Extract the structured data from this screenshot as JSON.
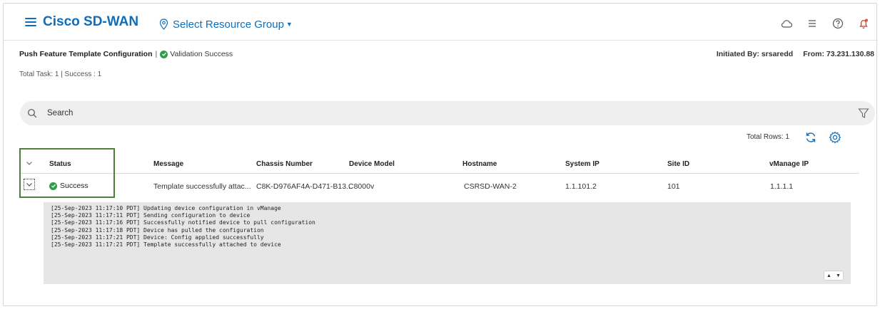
{
  "header": {
    "brand": "Cisco SD-WAN",
    "resource_group": "Select Resource Group",
    "icons": [
      "cloud-icon",
      "list-icon",
      "help-icon",
      "bell-icon"
    ]
  },
  "task": {
    "title": "Push Feature Template Configuration",
    "separator": "|",
    "validation": "Validation Success",
    "initiated_by": "Initiated By: srsaredd",
    "from": "From: 73.231.130.88",
    "summary": "Total Task: 1 | Success : 1"
  },
  "search": {
    "placeholder": "Search"
  },
  "table": {
    "total_rows": "Total Rows: 1",
    "columns": [
      "Status",
      "Message",
      "Chassis Number",
      "Device Model",
      "Hostname",
      "System IP",
      "Site ID",
      "vManage IP"
    ],
    "rows": [
      {
        "status": "Success",
        "message": "Template successfully attac...",
        "chassis": "C8K-D976AF4A-D471-B13...",
        "model": "C8000v",
        "hostname": "CSRSD-WAN-2",
        "system_ip": "1.1.101.2",
        "site_id": "101",
        "vmanage_ip": "1.1.1.1"
      }
    ]
  },
  "log": {
    "lines": [
      "[25-Sep-2023 11:17:10 PDT] Updating device configuration in vManage",
      "[25-Sep-2023 11:17:11 PDT] Sending configuration to device",
      "[25-Sep-2023 11:17:16 PDT] Successfully notified device to pull configuration",
      "[25-Sep-2023 11:17:18 PDT] Device has pulled the configuration",
      "[25-Sep-2023 11:17:21 PDT] Device: Config applied successfully",
      "[25-Sep-2023 11:17:21 PDT] Template successfully attached to device"
    ]
  },
  "colors": {
    "brand_blue": "#0d6ebd",
    "success_green": "#2e9e4b",
    "highlight_border": "#4f7f3a",
    "log_background": "#e6e6e6"
  }
}
